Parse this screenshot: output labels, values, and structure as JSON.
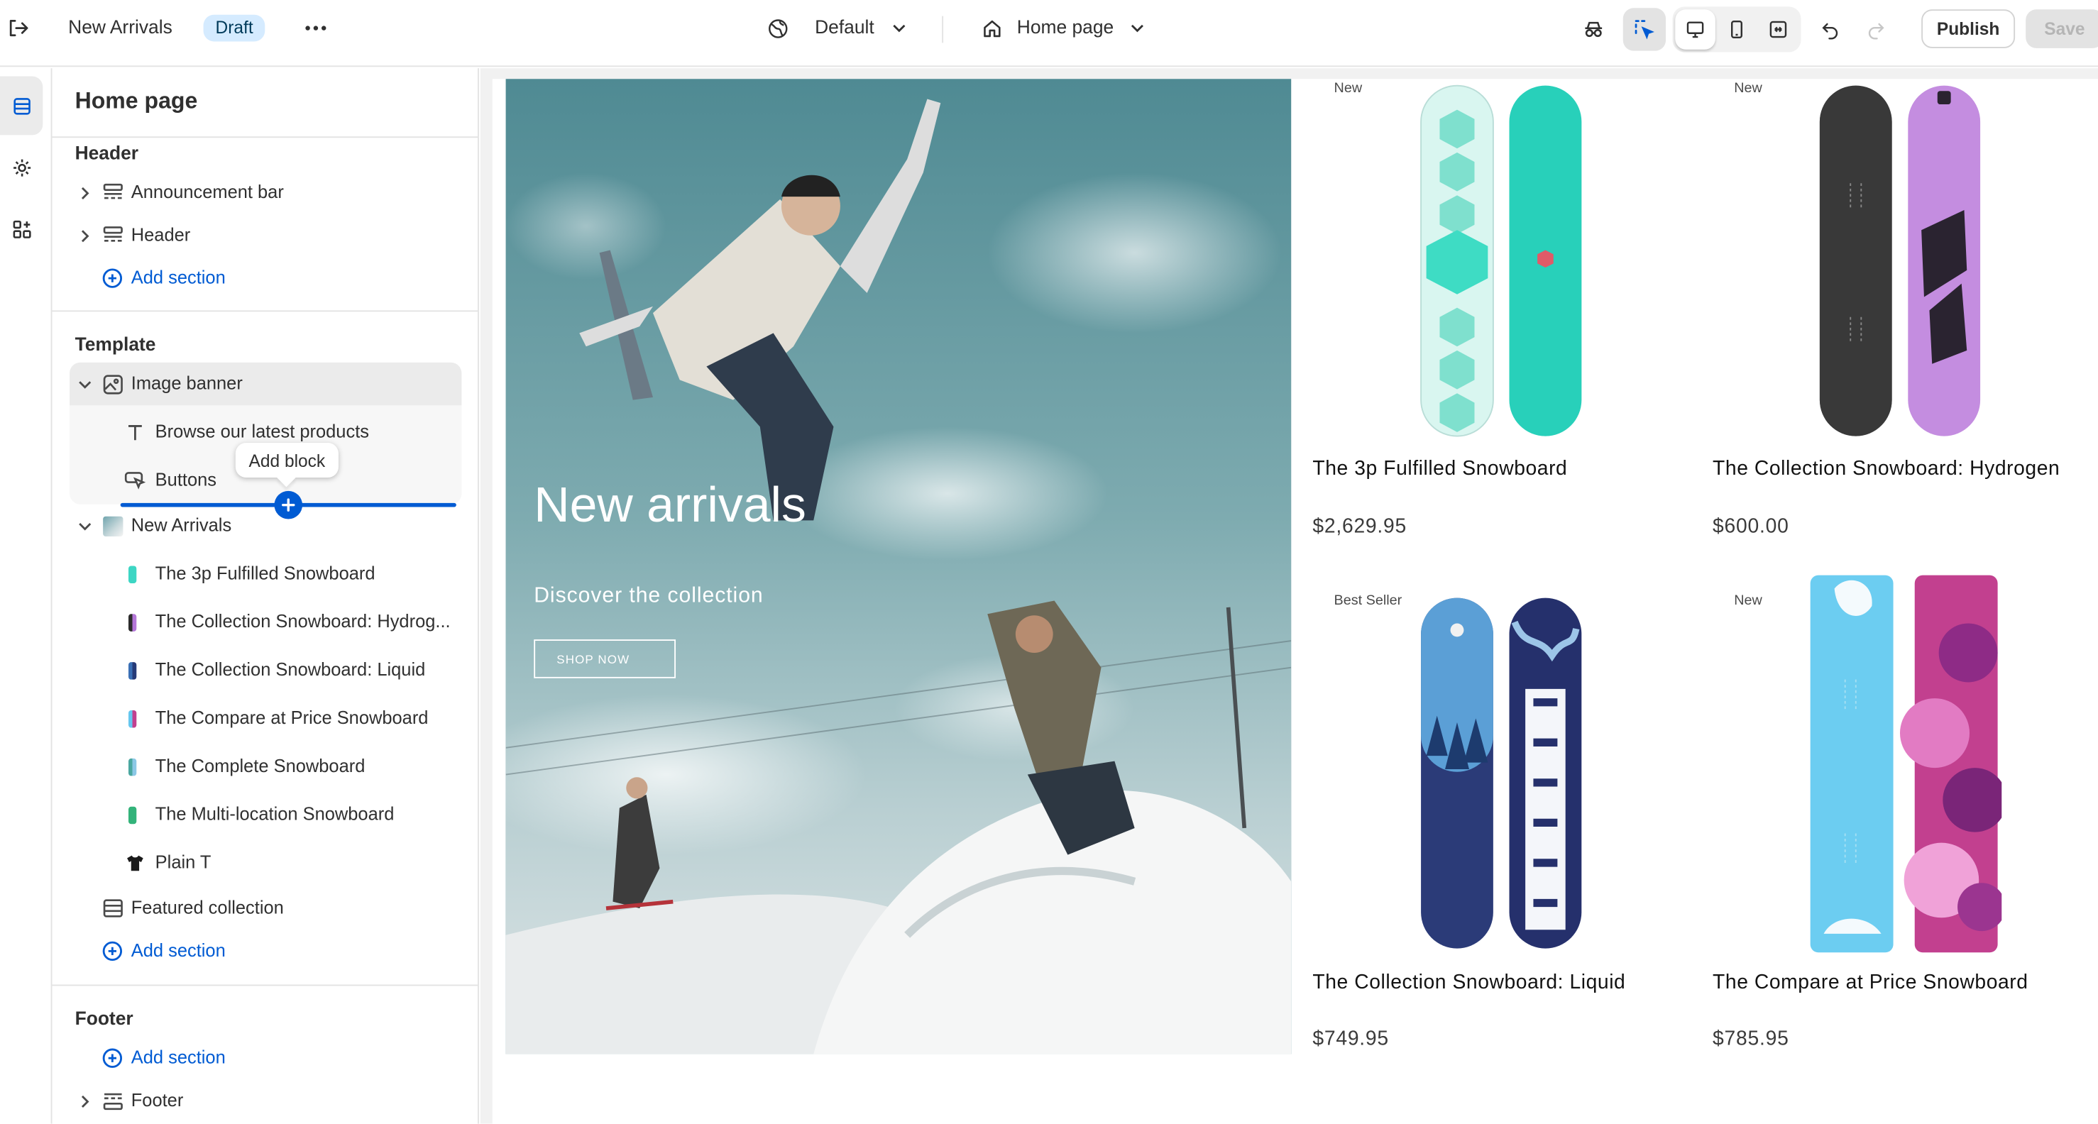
{
  "topbar": {
    "theme_name": "New Arrivals",
    "status_badge": "Draft",
    "view_selector": "Default",
    "page_selector": "Home page",
    "publish_label": "Publish",
    "save_label": "Save"
  },
  "sidebar": {
    "title": "Home page",
    "groups": {
      "header": {
        "label": "Header",
        "items": [
          "Announcement bar",
          "Header"
        ],
        "add_label": "Add section"
      },
      "template": {
        "label": "Template",
        "image_banner": {
          "label": "Image banner",
          "blocks": [
            "Browse our latest products",
            "Buttons"
          ]
        },
        "add_block_tooltip": "Add block",
        "new_arrivals": {
          "label": "New Arrivals",
          "products": [
            {
              "name": "The 3p Fulfilled Snowboard",
              "color": "#3dd6c4"
            },
            {
              "name": "The Collection Snowboard: Hydrog...",
              "color": "#b476d8"
            },
            {
              "name": "The Collection Snowboard: Liquid",
              "color": "#3a6fb5"
            },
            {
              "name": "The Compare at Price Snowboard",
              "color": "#c2408f"
            },
            {
              "name": "The Complete Snowboard",
              "color": "#4aa7a0"
            },
            {
              "name": "The Multi-location Snowboard",
              "color": "#33b37a"
            },
            {
              "name": "Plain T",
              "color": "#1a1a1a"
            }
          ]
        },
        "featured_collection": "Featured collection",
        "add_label": "Add section"
      },
      "footer": {
        "label": "Footer",
        "add_label": "Add section",
        "items": [
          "Footer"
        ]
      }
    }
  },
  "preview": {
    "hero": {
      "title": "New arrivals",
      "subtitle": "Discover the collection",
      "button_label": "SHOP NOW"
    },
    "products": [
      {
        "tag": "New",
        "name": "The 3p Fulfilled Snowboard",
        "price": "$2,629.95"
      },
      {
        "tag": "New",
        "name": "The Collection Snowboard: Hydrogen",
        "price": "$600.00"
      },
      {
        "tag": "Best Seller",
        "name": "The Collection Snowboard: Liquid",
        "price": "$749.95"
      },
      {
        "tag": "New",
        "name": "The Compare at Price Snowboard",
        "price": "$785.95"
      }
    ]
  },
  "colors": {
    "accent": "#005bd3",
    "badge_bg": "#d5ebff"
  }
}
